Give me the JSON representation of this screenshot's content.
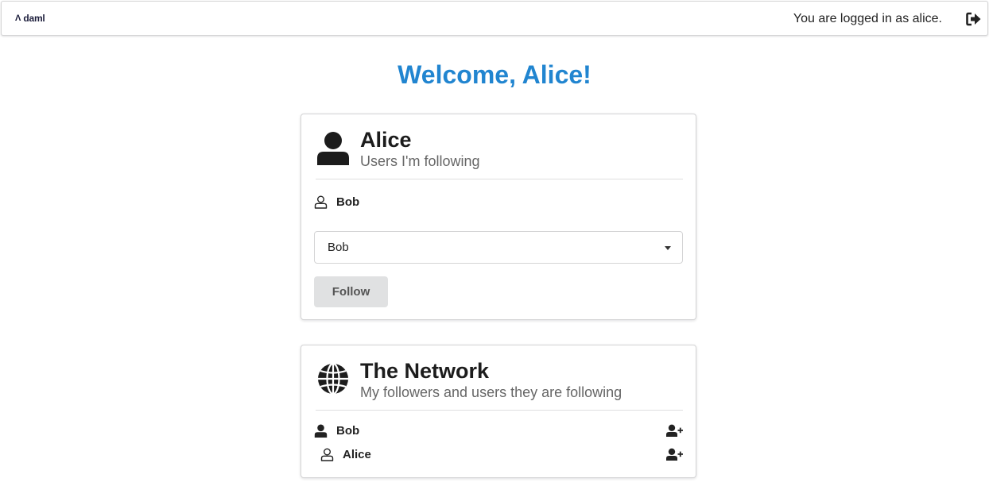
{
  "header": {
    "logo_mark": "Λ",
    "logo_text": "daml",
    "login_status": "You are logged in as alice.",
    "logout_icon": "sign-out-icon"
  },
  "welcome": "Welcome, Alice!",
  "following_card": {
    "title": "Alice",
    "subtitle": "Users I'm following",
    "icon": "user-icon",
    "following": [
      {
        "name": "Bob",
        "icon": "user-outline-icon"
      }
    ],
    "select": {
      "value": "Bob"
    },
    "follow_label": "Follow"
  },
  "network_card": {
    "title": "The Network",
    "subtitle": "My followers and users they are following",
    "icon": "globe-icon",
    "users": [
      {
        "name": "Bob",
        "icon": "user-icon",
        "action_icon": "user-plus-icon"
      },
      {
        "name": "Alice",
        "icon": "user-outline-icon",
        "action_icon": "user-plus-icon"
      }
    ]
  },
  "colors": {
    "accent": "#2185d0",
    "button_bg": "#e0e1e2",
    "border": "#d4d4d5"
  }
}
